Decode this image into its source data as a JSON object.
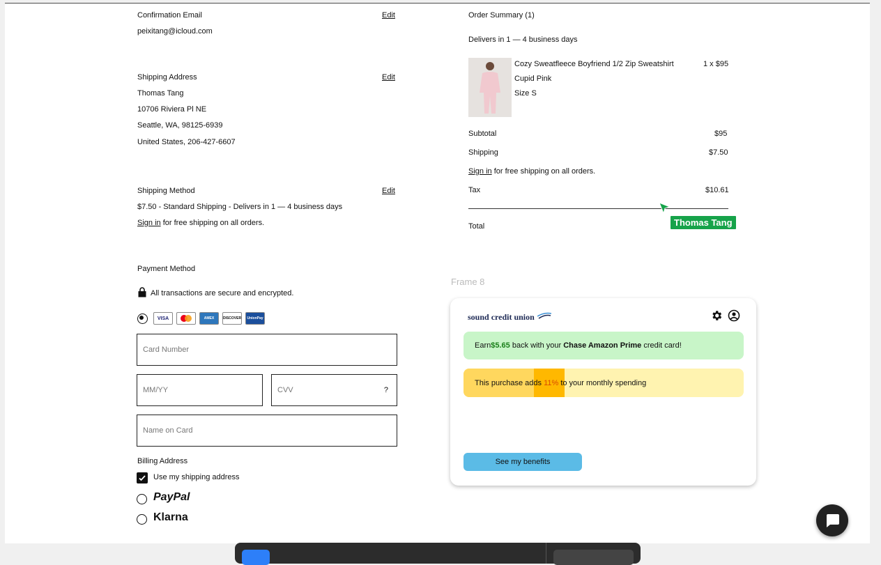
{
  "left": {
    "confirmation": {
      "heading": "Confirmation Email",
      "edit": "Edit",
      "email": "peixitang@icloud.com"
    },
    "shipping_address": {
      "heading": "Shipping Address",
      "edit": "Edit",
      "lines": [
        "Thomas Tang",
        "10706 Riviera Pl NE",
        "Seattle, WA, 98125-6939",
        "United States, 206-427-6607"
      ]
    },
    "shipping_method": {
      "heading": "Shipping Method",
      "edit": "Edit",
      "line": "$7.50 - Standard Shipping - Delivers in 1 — 4 business days",
      "signin_link": "Sign in",
      "signin_rest": " for free shipping on all orders."
    },
    "payment": {
      "heading": "Payment Method",
      "secure_text": "All transactions are secure and encrypted.",
      "cards": [
        "VISA",
        "MC",
        "AMEX",
        "DISCOVER",
        "UnionPay"
      ],
      "card_number_placeholder": "Card Number",
      "mmyy_placeholder": "MM/YY",
      "cvv_placeholder": "CVV",
      "cvv_help": "?",
      "name_placeholder": "Name on Card",
      "billing_heading": "Billing Address",
      "use_shipping": "Use my shipping address",
      "paypal": "PayPal",
      "klarna": "Klarna"
    }
  },
  "summary": {
    "heading": "Order Summary (1)",
    "delivery": "Delivers in 1 — 4 business days",
    "item": {
      "name": "Cozy Sweatfleece Boyfriend 1/2 Zip Sweatshirt",
      "qty_price": "1 x $95",
      "color": "Cupid Pink",
      "size": "Size S"
    },
    "subtotal_label": "Subtotal",
    "subtotal": "$95",
    "shipping_label": "Shipping",
    "shipping": "$7.50",
    "signin_link": "Sign in",
    "signin_rest": " for free shipping on all orders.",
    "tax_label": "Tax",
    "tax": "$10.61",
    "total_label": "Total",
    "cursor_user": "Thomas Tang"
  },
  "frame8": {
    "label": "Frame 8",
    "brand": "sound credit union",
    "earn_pre": "Earn ",
    "earn_amount": "$5.65",
    "earn_mid": " back with your ",
    "earn_card": "Chase Amazon Prime",
    "earn_post": " credit card!",
    "spend_pre": "This purchase adds ",
    "spend_pct": "11%",
    "spend_post": " to your monthly spending",
    "spend_level": 0.11,
    "benefits_button": "See my benefits"
  },
  "colors": {
    "earn_bg": "#c8f5c8",
    "earn_amount": "#1a7f1a",
    "spend_bg": "#fff3b0",
    "spend_fill": "#ffd75e",
    "spend_highlight": "#ffb800",
    "button": "#5bbbe6",
    "cursor_tag": "#16a34a"
  },
  "icons": [
    "lock-icon",
    "gear-icon",
    "user-circle-icon",
    "chat-icon",
    "checkmark-icon",
    "cursor-arrow-icon"
  ]
}
